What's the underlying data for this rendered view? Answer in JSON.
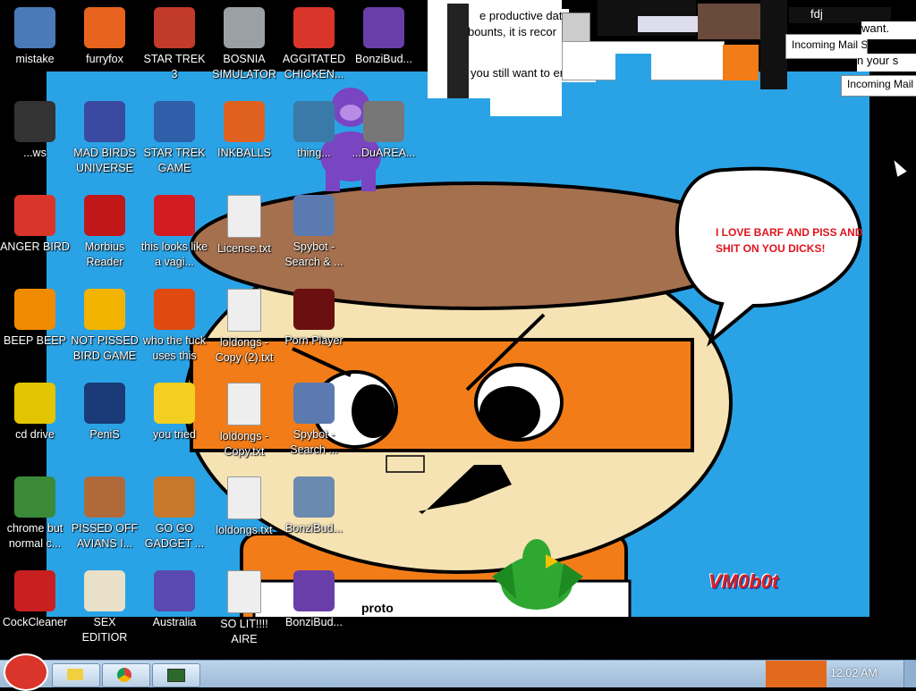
{
  "wallpaper": {
    "speech_bubble": "I LOVE BARF AND PISS AND SHIT ON YOU DICKS!",
    "watermark": "VM0b0t",
    "shirt_text": "proto",
    "colors": {
      "sky": "#2aa3e6",
      "hat": "#a5704e",
      "face": "#f6e3b4",
      "mask": "#f27d18",
      "shirt": "#f27d18"
    }
  },
  "desktop_icons": [
    {
      "label": "mistake",
      "icon": "computer-warning-icon",
      "color": "#4a7ab8"
    },
    {
      "label": "furryfox",
      "icon": "firefox-icon",
      "color": "#e8641e"
    },
    {
      "label": "STAR TREK 3",
      "icon": "star-trek-icon",
      "color": "#c23a2a"
    },
    {
      "label": "BOSNIA SIMULATOR",
      "icon": "explosion-icon",
      "color": "#9aa0a6"
    },
    {
      "label": "AGGITATED CHICKEN...",
      "icon": "angry-bird-icon",
      "color": "#d9352a"
    },
    {
      "label": "BonziBud...",
      "icon": "bonzi-icon",
      "color": "#6a3ea8"
    },
    {
      "label": "...ws",
      "icon": "trash-warning-icon",
      "color": "#333"
    },
    {
      "label": "MAD BIRDS UNIVERSE",
      "icon": "angry-bird-space-icon",
      "color": "#3a4aa0"
    },
    {
      "label": "STAR TREK GAME",
      "icon": "star-wars-icon",
      "color": "#2e5fa8"
    },
    {
      "label": "INKBALLS",
      "icon": "inkball-icon",
      "color": "#e06020"
    },
    {
      "label": "thing...",
      "icon": "program-icon",
      "color": "#3a7aa8"
    },
    {
      "label": "...DuAREA...",
      "icon": "gears-icon",
      "color": "#777"
    },
    {
      "label": "ANGER BIRD",
      "icon": "angry-bird-icon",
      "color": "#d9352a"
    },
    {
      "label": "Morbius Reader",
      "icon": "acrobat-icon",
      "color": "#c01818"
    },
    {
      "label": "this looks like a vagi...",
      "icon": "opera-icon",
      "color": "#d31b24"
    },
    {
      "label": "License.txt",
      "icon": "text-file-icon",
      "color": "#eee"
    },
    {
      "label": "Spybot - Search & ...",
      "icon": "spybot-icon",
      "color": "#5a7ab0"
    },
    {
      "label": "BEEP BEEP",
      "icon": "vlc-icon",
      "color": "#f08a00"
    },
    {
      "label": "NOT PISSED BIRD GAME",
      "icon": "bad-piggies-icon",
      "color": "#f2b400"
    },
    {
      "label": "who the fuck uses this",
      "icon": "winamp-icon",
      "color": "#e04a10"
    },
    {
      "label": "loldongs - Copy (2).txt",
      "icon": "text-file-icon",
      "color": "#eee"
    },
    {
      "label": "Porn Player",
      "icon": "flash-icon",
      "color": "#6a1010"
    },
    {
      "label": "cd drive",
      "icon": "cd-icon",
      "color": "#e2c400"
    },
    {
      "label": "PeniS",
      "icon": "photoshop-icon",
      "color": "#1a3a78"
    },
    {
      "label": "you tried",
      "icon": "star-icon",
      "color": "#f2cf20"
    },
    {
      "label": "loldongs - Copy.txt",
      "icon": "text-file-icon",
      "color": "#eee"
    },
    {
      "label": "Spybot - Search ...",
      "icon": "spybot-icon",
      "color": "#5a7ab0"
    },
    {
      "label": "chrome but normal c...",
      "icon": "chrome-icon",
      "color": "#3a8a3a"
    },
    {
      "label": "PISSED OFF AVIANS I...",
      "icon": "angry-birds-seasons-icon",
      "color": "#b06a3a"
    },
    {
      "label": "GO GO GADGET ...",
      "icon": "briefcase-icon",
      "color": "#c8782a"
    },
    {
      "label": "loldongs.txt",
      "icon": "text-file-icon",
      "color": "#eee"
    },
    {
      "label": "BonziBud...",
      "icon": "window-icon",
      "color": "#6a8ab0"
    },
    {
      "label": "CockCleaner",
      "icon": "ccleaner-icon",
      "color": "#c82020"
    },
    {
      "label": "SEX EDITIOR",
      "icon": "hxd-icon",
      "color": "#e8e0c8"
    },
    {
      "label": "Australia",
      "icon": "spider-solitaire-icon",
      "color": "#5a4ab0"
    },
    {
      "label": "SO LIT!!!! AIRE",
      "icon": "cards-icon",
      "color": "#eee"
    },
    {
      "label": "BonziBud...",
      "icon": "bonzi-icon",
      "color": "#6a3ea8"
    }
  ],
  "glitch_texts": {
    "t1": "e productive dat",
    "t2": "exobounts, it is recor",
    "t3": "you still want to enable",
    "t4": "Incoming Mail S",
    "t5": "Incoming Mail Server",
    "t6": "n your s",
    "t7": "fdj",
    "t8": "want."
  },
  "taskbar": {
    "clock": "12:02 AM"
  }
}
